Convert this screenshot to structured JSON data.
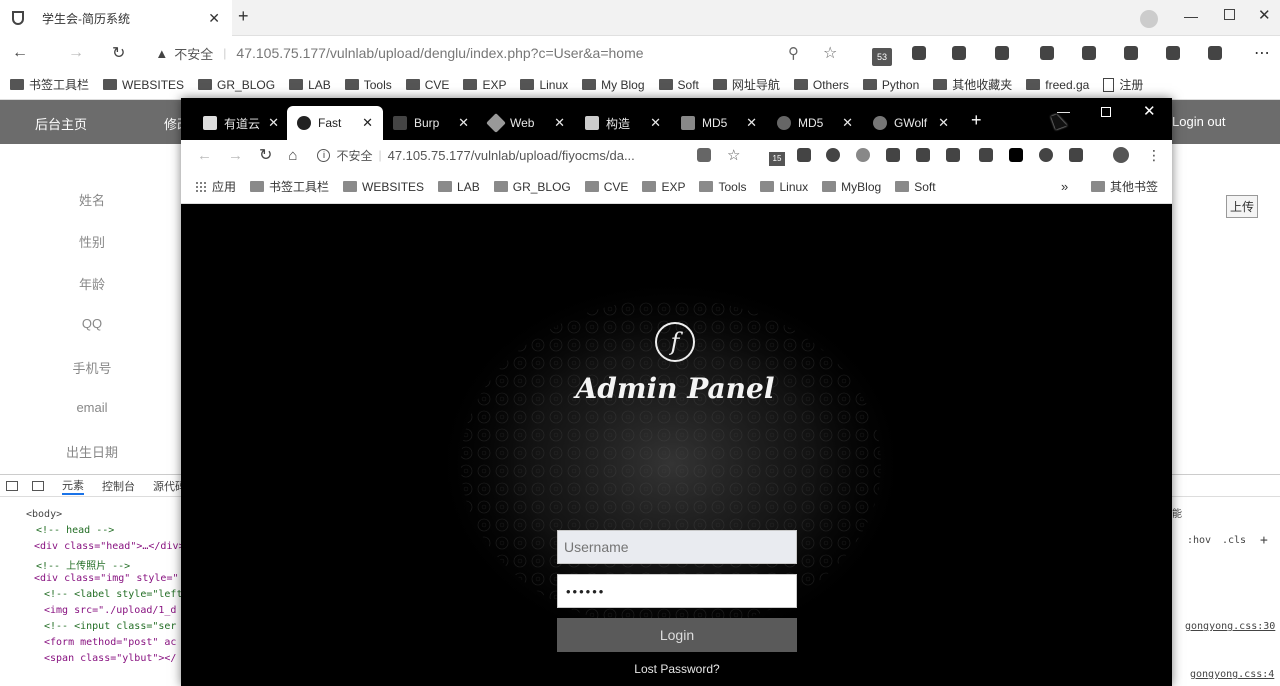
{
  "back_window": {
    "tab_title": "学生会-简历系统",
    "address": {
      "security_label": "不安全",
      "url": "47.105.75.177/vulnlab/upload/denglu/index.php?c=User&a=home"
    },
    "extension_badge": "53",
    "bookmarks": [
      "书签工具栏",
      "WEBSITES",
      "GR_BLOG",
      "LAB",
      "Tools",
      "CVE",
      "EXP",
      "Linux",
      "My Blog",
      "Soft",
      "网址导航",
      "Others",
      "Python",
      "其他收藏夹",
      "freed.ga",
      "注册"
    ],
    "nav": {
      "home": "后台主页",
      "edit": "修改",
      "logout": "Login out"
    },
    "sidebar_fields": [
      "姓名",
      "性别",
      "年龄",
      "QQ",
      "手机号",
      "email",
      "出生日期"
    ],
    "upload_button": "上传",
    "devtools": {
      "tabs": [
        "元素",
        "控制台",
        "源代码"
      ],
      "styles_tools": [
        ":hov",
        ".cls",
        "+"
      ],
      "side_label": "能",
      "css_refs": [
        "gongyong.css:30",
        "gongyong.css:4"
      ],
      "lines": [
        "<body>",
        "<!-- head -->",
        "<div class=\"head\">…</div>",
        "<!-- 上传照片 -->",
        "<div class=\"img\" style=\"",
        "<!-- <label style=\"left",
        "<img src=\"./upload/1_d",
        "<!-- <input class=\"ser",
        "<form method=\"post\" ac",
        "<span class=\"ylbut\"></"
      ]
    }
  },
  "front_window": {
    "tabs": [
      {
        "label": "有道云",
        "active": false
      },
      {
        "label": "Fast",
        "active": true
      },
      {
        "label": "Burp",
        "active": false
      },
      {
        "label": "Web",
        "active": false
      },
      {
        "label": "构造",
        "active": false
      },
      {
        "label": "MD5",
        "active": false
      },
      {
        "label": "MD5",
        "active": false
      },
      {
        "label": "GWolf",
        "active": false
      }
    ],
    "address": {
      "security_label": "不安全",
      "url": "47.105.75.177/vulnlab/upload/fiyocms/da..."
    },
    "extension_badge": "15",
    "bookmarks": [
      "应用",
      "书签工具栏",
      "WEBSITES",
      "LAB",
      "GR_BLOG",
      "CVE",
      "EXP",
      "Tools",
      "Linux",
      "MyBlog",
      "Soft"
    ],
    "bookmarks_more": "»",
    "other_bookmarks": "其他书签",
    "panel": {
      "title": "Admin Panel",
      "username_placeholder": "Username",
      "password_value": "••••••",
      "login_button": "Login",
      "lost_password": "Lost Password?"
    }
  }
}
